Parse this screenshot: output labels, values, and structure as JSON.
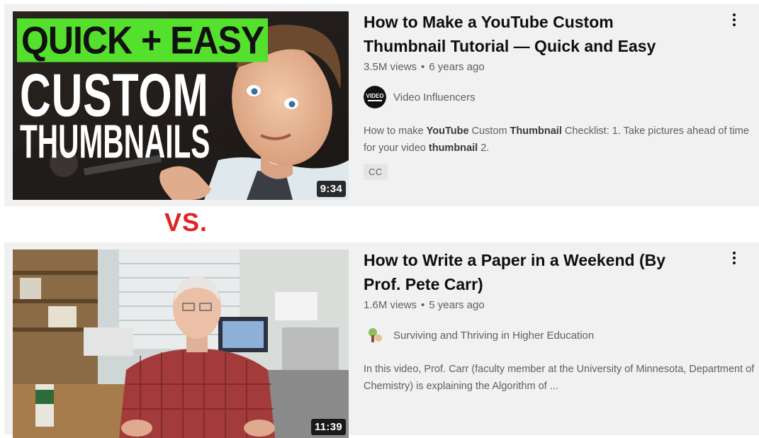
{
  "videos": [
    {
      "title": "How to Make a YouTube Custom Thumbnail Tutorial — Quick and Easy",
      "views": "3.5M views",
      "age": "6 years ago",
      "channel": "Video Influencers",
      "channel_avatar_text": "VIDEO",
      "description_parts": [
        "How to make ",
        "YouTube",
        " Custom ",
        "Thumbnail",
        " Checklist: 1. Take pictures ahead of time for your video ",
        "thumbnail",
        " 2."
      ],
      "badge": "CC",
      "duration": "9:34",
      "thumbnail_text": {
        "line1": "QUICK + EASY",
        "line2": "CUSTOM",
        "line3": "THUMBNAILS"
      }
    },
    {
      "title": "How to Write a Paper in a Weekend (By Prof. Pete Carr)",
      "views": "1.6M views",
      "age": "5 years ago",
      "channel": "Surviving and Thriving in Higher Education",
      "description": "In this video, Prof. Carr (faculty member at the University of Minnesota, Department of Chemistry) is explaining the Algorithm of ...",
      "duration": "11:39"
    }
  ],
  "separator_label": "VS.",
  "colors": {
    "accent_red": "#e02424",
    "thumb_green": "#55e02e",
    "card_bg": "#f1f1f1"
  }
}
